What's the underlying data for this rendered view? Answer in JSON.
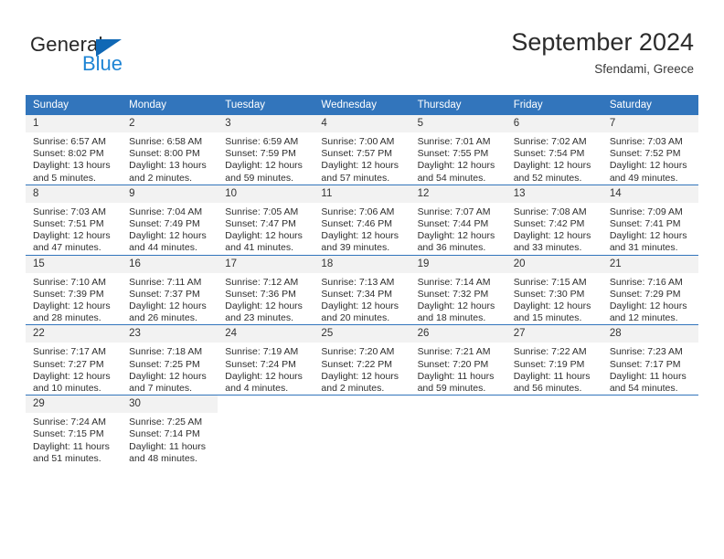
{
  "brand": {
    "name_top": "General",
    "name_bottom": "Blue",
    "accent_color": "#1068b5",
    "blue_text_color": "#1e84d4"
  },
  "header": {
    "title": "September 2024",
    "subtitle": "Sfendami, Greece"
  },
  "theme": {
    "header_band": "#3275bc",
    "daynum_band": "#f2f2f2",
    "text": "#2e2e2e"
  },
  "weekday_headers": [
    "Sunday",
    "Monday",
    "Tuesday",
    "Wednesday",
    "Thursday",
    "Friday",
    "Saturday"
  ],
  "labels": {
    "sunrise_prefix": "Sunrise:",
    "sunset_prefix": "Sunset:",
    "daylight_prefix": "Daylight:"
  },
  "weeks": [
    [
      {
        "day": "1",
        "sunrise": "Sunrise: 6:57 AM",
        "sunset": "Sunset: 8:02 PM",
        "daylight_1": "Daylight: 13 hours",
        "daylight_2": "and 5 minutes."
      },
      {
        "day": "2",
        "sunrise": "Sunrise: 6:58 AM",
        "sunset": "Sunset: 8:00 PM",
        "daylight_1": "Daylight: 13 hours",
        "daylight_2": "and 2 minutes."
      },
      {
        "day": "3",
        "sunrise": "Sunrise: 6:59 AM",
        "sunset": "Sunset: 7:59 PM",
        "daylight_1": "Daylight: 12 hours",
        "daylight_2": "and 59 minutes."
      },
      {
        "day": "4",
        "sunrise": "Sunrise: 7:00 AM",
        "sunset": "Sunset: 7:57 PM",
        "daylight_1": "Daylight: 12 hours",
        "daylight_2": "and 57 minutes."
      },
      {
        "day": "5",
        "sunrise": "Sunrise: 7:01 AM",
        "sunset": "Sunset: 7:55 PM",
        "daylight_1": "Daylight: 12 hours",
        "daylight_2": "and 54 minutes."
      },
      {
        "day": "6",
        "sunrise": "Sunrise: 7:02 AM",
        "sunset": "Sunset: 7:54 PM",
        "daylight_1": "Daylight: 12 hours",
        "daylight_2": "and 52 minutes."
      },
      {
        "day": "7",
        "sunrise": "Sunrise: 7:03 AM",
        "sunset": "Sunset: 7:52 PM",
        "daylight_1": "Daylight: 12 hours",
        "daylight_2": "and 49 minutes."
      }
    ],
    [
      {
        "day": "8",
        "sunrise": "Sunrise: 7:03 AM",
        "sunset": "Sunset: 7:51 PM",
        "daylight_1": "Daylight: 12 hours",
        "daylight_2": "and 47 minutes."
      },
      {
        "day": "9",
        "sunrise": "Sunrise: 7:04 AM",
        "sunset": "Sunset: 7:49 PM",
        "daylight_1": "Daylight: 12 hours",
        "daylight_2": "and 44 minutes."
      },
      {
        "day": "10",
        "sunrise": "Sunrise: 7:05 AM",
        "sunset": "Sunset: 7:47 PM",
        "daylight_1": "Daylight: 12 hours",
        "daylight_2": "and 41 minutes."
      },
      {
        "day": "11",
        "sunrise": "Sunrise: 7:06 AM",
        "sunset": "Sunset: 7:46 PM",
        "daylight_1": "Daylight: 12 hours",
        "daylight_2": "and 39 minutes."
      },
      {
        "day": "12",
        "sunrise": "Sunrise: 7:07 AM",
        "sunset": "Sunset: 7:44 PM",
        "daylight_1": "Daylight: 12 hours",
        "daylight_2": "and 36 minutes."
      },
      {
        "day": "13",
        "sunrise": "Sunrise: 7:08 AM",
        "sunset": "Sunset: 7:42 PM",
        "daylight_1": "Daylight: 12 hours",
        "daylight_2": "and 33 minutes."
      },
      {
        "day": "14",
        "sunrise": "Sunrise: 7:09 AM",
        "sunset": "Sunset: 7:41 PM",
        "daylight_1": "Daylight: 12 hours",
        "daylight_2": "and 31 minutes."
      }
    ],
    [
      {
        "day": "15",
        "sunrise": "Sunrise: 7:10 AM",
        "sunset": "Sunset: 7:39 PM",
        "daylight_1": "Daylight: 12 hours",
        "daylight_2": "and 28 minutes."
      },
      {
        "day": "16",
        "sunrise": "Sunrise: 7:11 AM",
        "sunset": "Sunset: 7:37 PM",
        "daylight_1": "Daylight: 12 hours",
        "daylight_2": "and 26 minutes."
      },
      {
        "day": "17",
        "sunrise": "Sunrise: 7:12 AM",
        "sunset": "Sunset: 7:36 PM",
        "daylight_1": "Daylight: 12 hours",
        "daylight_2": "and 23 minutes."
      },
      {
        "day": "18",
        "sunrise": "Sunrise: 7:13 AM",
        "sunset": "Sunset: 7:34 PM",
        "daylight_1": "Daylight: 12 hours",
        "daylight_2": "and 20 minutes."
      },
      {
        "day": "19",
        "sunrise": "Sunrise: 7:14 AM",
        "sunset": "Sunset: 7:32 PM",
        "daylight_1": "Daylight: 12 hours",
        "daylight_2": "and 18 minutes."
      },
      {
        "day": "20",
        "sunrise": "Sunrise: 7:15 AM",
        "sunset": "Sunset: 7:30 PM",
        "daylight_1": "Daylight: 12 hours",
        "daylight_2": "and 15 minutes."
      },
      {
        "day": "21",
        "sunrise": "Sunrise: 7:16 AM",
        "sunset": "Sunset: 7:29 PM",
        "daylight_1": "Daylight: 12 hours",
        "daylight_2": "and 12 minutes."
      }
    ],
    [
      {
        "day": "22",
        "sunrise": "Sunrise: 7:17 AM",
        "sunset": "Sunset: 7:27 PM",
        "daylight_1": "Daylight: 12 hours",
        "daylight_2": "and 10 minutes."
      },
      {
        "day": "23",
        "sunrise": "Sunrise: 7:18 AM",
        "sunset": "Sunset: 7:25 PM",
        "daylight_1": "Daylight: 12 hours",
        "daylight_2": "and 7 minutes."
      },
      {
        "day": "24",
        "sunrise": "Sunrise: 7:19 AM",
        "sunset": "Sunset: 7:24 PM",
        "daylight_1": "Daylight: 12 hours",
        "daylight_2": "and 4 minutes."
      },
      {
        "day": "25",
        "sunrise": "Sunrise: 7:20 AM",
        "sunset": "Sunset: 7:22 PM",
        "daylight_1": "Daylight: 12 hours",
        "daylight_2": "and 2 minutes."
      },
      {
        "day": "26",
        "sunrise": "Sunrise: 7:21 AM",
        "sunset": "Sunset: 7:20 PM",
        "daylight_1": "Daylight: 11 hours",
        "daylight_2": "and 59 minutes."
      },
      {
        "day": "27",
        "sunrise": "Sunrise: 7:22 AM",
        "sunset": "Sunset: 7:19 PM",
        "daylight_1": "Daylight: 11 hours",
        "daylight_2": "and 56 minutes."
      },
      {
        "day": "28",
        "sunrise": "Sunrise: 7:23 AM",
        "sunset": "Sunset: 7:17 PM",
        "daylight_1": "Daylight: 11 hours",
        "daylight_2": "and 54 minutes."
      }
    ],
    [
      {
        "day": "29",
        "sunrise": "Sunrise: 7:24 AM",
        "sunset": "Sunset: 7:15 PM",
        "daylight_1": "Daylight: 11 hours",
        "daylight_2": "and 51 minutes."
      },
      {
        "day": "30",
        "sunrise": "Sunrise: 7:25 AM",
        "sunset": "Sunset: 7:14 PM",
        "daylight_1": "Daylight: 11 hours",
        "daylight_2": "and 48 minutes."
      },
      {
        "day": "",
        "sunrise": "",
        "sunset": "",
        "daylight_1": "",
        "daylight_2": ""
      },
      {
        "day": "",
        "sunrise": "",
        "sunset": "",
        "daylight_1": "",
        "daylight_2": ""
      },
      {
        "day": "",
        "sunrise": "",
        "sunset": "",
        "daylight_1": "",
        "daylight_2": ""
      },
      {
        "day": "",
        "sunrise": "",
        "sunset": "",
        "daylight_1": "",
        "daylight_2": ""
      },
      {
        "day": "",
        "sunrise": "",
        "sunset": "",
        "daylight_1": "",
        "daylight_2": ""
      }
    ]
  ]
}
